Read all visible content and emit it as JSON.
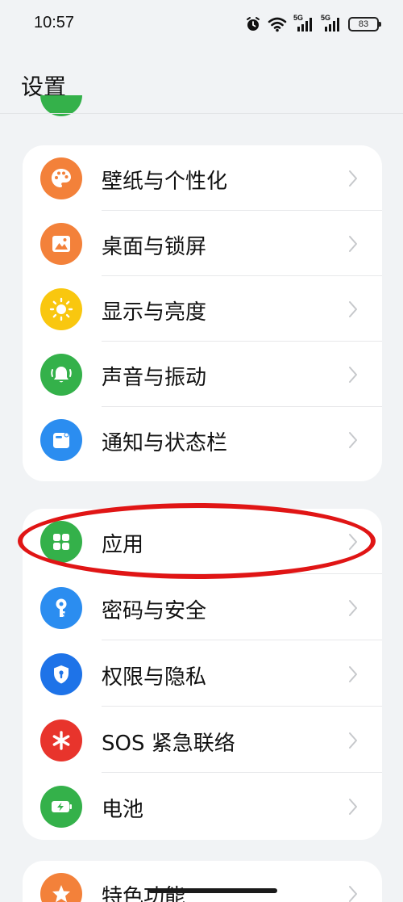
{
  "status_bar": {
    "time": "10:57",
    "network_1": "5G",
    "network_2": "5G",
    "battery": "83",
    "icons": [
      "alarm-icon",
      "wifi-icon",
      "signal-icon",
      "signal-icon",
      "battery-icon"
    ]
  },
  "header": {
    "title": "设置"
  },
  "groups": [
    {
      "items": [
        {
          "label": "壁纸与个性化",
          "icon": "palette-icon",
          "color": "#f3813a"
        },
        {
          "label": "桌面与锁屏",
          "icon": "picture-icon",
          "color": "#f3813a"
        },
        {
          "label": "显示与亮度",
          "icon": "sun-icon",
          "color": "#f9c70f"
        },
        {
          "label": "声音与振动",
          "icon": "bell-icon",
          "color": "#34b14a"
        },
        {
          "label": "通知与状态栏",
          "icon": "notification-icon",
          "color": "#2b8df0"
        }
      ]
    },
    {
      "items": [
        {
          "label": "应用",
          "icon": "apps-grid-icon",
          "color": "#34b14a"
        },
        {
          "label": "密码与安全",
          "icon": "key-icon",
          "color": "#2b8df0"
        },
        {
          "label": "权限与隐私",
          "icon": "shield-icon",
          "color": "#1e73e8"
        },
        {
          "label": "SOS 紧急联络",
          "icon": "sos-asterisk-icon",
          "color": "#e8342c"
        },
        {
          "label": "电池",
          "icon": "battery-charge-icon",
          "color": "#34b14a"
        }
      ]
    },
    {
      "items": [
        {
          "label": "特色功能",
          "icon": "star-icon",
          "color": "#f3813a"
        }
      ]
    }
  ],
  "annotation": {
    "color": "#e01515",
    "highlighted_item": "应用"
  }
}
